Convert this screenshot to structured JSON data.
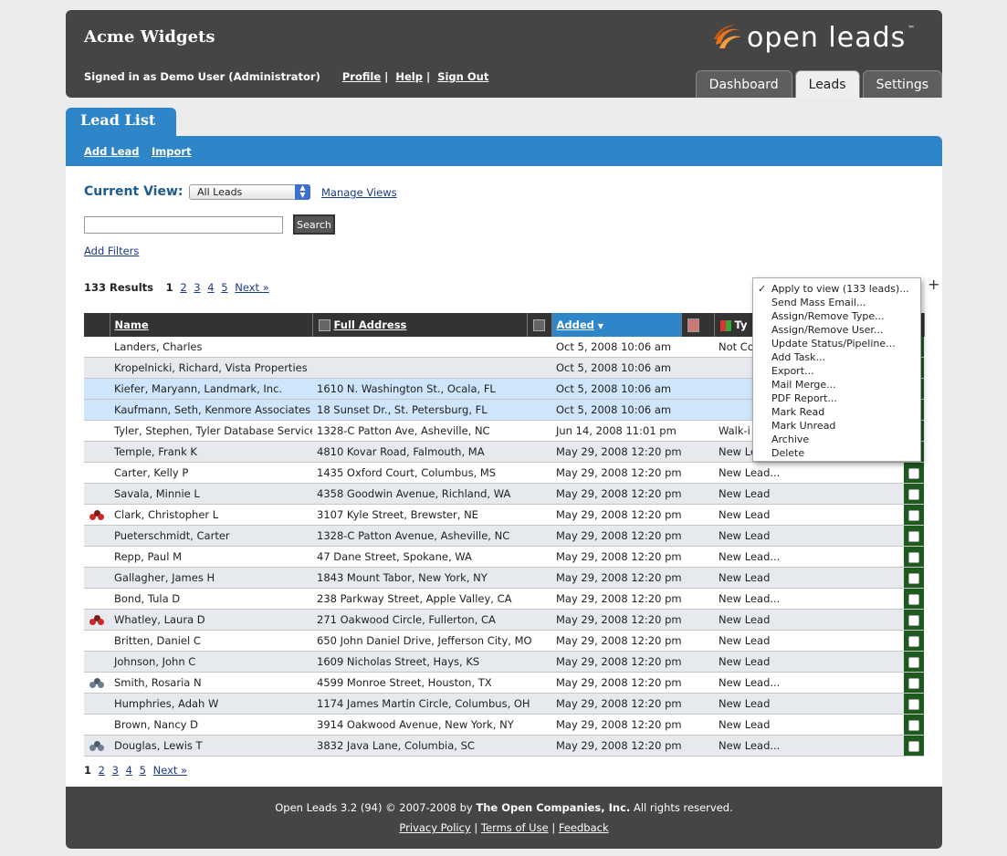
{
  "header": {
    "company": "Acme Widgets",
    "signed_in": "Signed in as Demo User (Administrator)",
    "links": {
      "profile": "Profile",
      "help": "Help",
      "sign_out": "Sign Out"
    },
    "logo": "open leads",
    "logo_tm": "™",
    "tabs": [
      "Dashboard",
      "Leads",
      "Settings"
    ],
    "active_tab": "Leads"
  },
  "page": {
    "title": "Lead List",
    "actions": {
      "add_lead": "Add Lead",
      "import": "Import"
    }
  },
  "controls": {
    "current_view_label": "Current View:",
    "current_view_value": "All Leads",
    "manage_views": "Manage Views",
    "search_value": "",
    "search_button": "Search",
    "add_filters": "Add Filters"
  },
  "results": {
    "count_label": "133 Results",
    "current_page": "1",
    "pages": [
      "2",
      "3",
      "4",
      "5"
    ],
    "next": "Next »"
  },
  "table": {
    "headers": {
      "name": "Name",
      "full_address": "Full Address",
      "added": "Added",
      "sort_arrow": "▼",
      "type": "Ty"
    },
    "rows": [
      {
        "icon": "",
        "name": "Landers, Charles",
        "address": "",
        "added": "Oct 5, 2008 10:06 am",
        "type": "Not Co",
        "style": "odd"
      },
      {
        "icon": "",
        "name": "Kropelnicki, Richard, Vista Properties",
        "address": "",
        "added": "Oct 5, 2008 10:06 am",
        "type": "",
        "style": "even"
      },
      {
        "icon": "",
        "name": "Kiefer, Maryann, Landmark, Inc.",
        "address": "1610 N. Washington St., Ocala, FL",
        "added": "Oct 5, 2008 10:06 am",
        "type": "",
        "style": "sel"
      },
      {
        "icon": "",
        "name": "Kaufmann, Seth, Kenmore Associates",
        "address": "18 Sunset Dr., St. Petersburg, FL",
        "added": "Oct 5, 2008 10:06 am",
        "type": "",
        "style": "sel"
      },
      {
        "icon": "",
        "name": "Tyler, Stephen, Tyler Database Services",
        "address": "1328-C Patton Ave, Asheville, NC",
        "added": "Jun 14, 2008 11:01 pm",
        "type": "Walk-i",
        "style": "odd"
      },
      {
        "icon": "",
        "name": "Temple, Frank K",
        "address": "4810 Kovar Road, Falmouth, MA",
        "added": "May 29, 2008 12:20 pm",
        "type": "New Le",
        "style": "even"
      },
      {
        "icon": "",
        "name": "Carter, Kelly P",
        "address": "1435 Oxford Court, Columbus, MS",
        "added": "May 29, 2008 12:20 pm",
        "type": "New Lead...",
        "style": "odd"
      },
      {
        "icon": "",
        "name": "Savala, Minnie L",
        "address": "4358 Goodwin Avenue, Richland, WA",
        "added": "May 29, 2008 12:20 pm",
        "type": "New Lead",
        "style": "even"
      },
      {
        "icon": "red",
        "name": "Clark, Christopher L",
        "address": "3107 Kyle Street, Brewster, NE",
        "added": "May 29, 2008 12:20 pm",
        "type": "New Lead",
        "style": "odd"
      },
      {
        "icon": "",
        "name": "Pueterschmidt, Carter",
        "address": "1328-C Patton Avenue, Asheville, NC",
        "added": "May 29, 2008 12:20 pm",
        "type": "New Lead",
        "style": "even"
      },
      {
        "icon": "",
        "name": "Repp, Paul M",
        "address": "47 Dane Street, Spokane, WA",
        "added": "May 29, 2008 12:20 pm",
        "type": "New Lead...",
        "style": "odd"
      },
      {
        "icon": "",
        "name": "Gallagher, James H",
        "address": "1843 Mount Tabor, New York, NY",
        "added": "May 29, 2008 12:20 pm",
        "type": "New Lead",
        "style": "even"
      },
      {
        "icon": "",
        "name": "Bond, Tula D",
        "address": "238 Parkway Street, Apple Valley, CA",
        "added": "May 29, 2008 12:20 pm",
        "type": "New Lead...",
        "style": "odd"
      },
      {
        "icon": "red",
        "name": "Whatley, Laura D",
        "address": "271 Oakwood Circle, Fullerton, CA",
        "added": "May 29, 2008 12:20 pm",
        "type": "New Lead",
        "style": "even"
      },
      {
        "icon": "",
        "name": "Britten, Daniel C",
        "address": "650 John Daniel Drive, Jefferson City, MO",
        "added": "May 29, 2008 12:20 pm",
        "type": "New Lead",
        "style": "odd"
      },
      {
        "icon": "",
        "name": "Johnson, John C",
        "address": "1609 Nicholas Street, Hays, KS",
        "added": "May 29, 2008 12:20 pm",
        "type": "New Lead",
        "style": "even"
      },
      {
        "icon": "gray",
        "name": "Smith, Rosaria N",
        "address": "4599 Monroe Street, Houston, TX",
        "added": "May 29, 2008 12:20 pm",
        "type": "New Lead...",
        "style": "odd"
      },
      {
        "icon": "",
        "name": "Humphries, Adah W",
        "address": "1174 James Martin Circle, Columbus, OH",
        "added": "May 29, 2008 12:20 pm",
        "type": "New Lead",
        "style": "even"
      },
      {
        "icon": "",
        "name": "Brown, Nancy D",
        "address": "3914 Oakwood Avenue, New York, NY",
        "added": "May 29, 2008 12:20 pm",
        "type": "New Lead",
        "style": "odd"
      },
      {
        "icon": "gray",
        "name": "Douglas, Lewis T",
        "address": "3832 Java Lane, Columbia, SC",
        "added": "May 29, 2008 12:20 pm",
        "type": "New Lead...",
        "style": "even"
      }
    ]
  },
  "menu": {
    "items": [
      {
        "label": "Apply to view (133 leads)...",
        "checked": true
      },
      {
        "label": "Send Mass Email...",
        "checked": false
      },
      {
        "label": "Assign/Remove Type...",
        "checked": false
      },
      {
        "label": "Assign/Remove User...",
        "checked": false
      },
      {
        "label": "Update Status/Pipeline...",
        "checked": false
      },
      {
        "label": "Add Task...",
        "checked": false
      },
      {
        "label": "Export...",
        "checked": false
      },
      {
        "label": "Mail Merge...",
        "checked": false
      },
      {
        "label": "PDF Report...",
        "checked": false
      },
      {
        "label": "Mark Read",
        "checked": false
      },
      {
        "label": "Mark Unread",
        "checked": false
      },
      {
        "label": "Archive",
        "checked": false
      },
      {
        "label": "Delete",
        "checked": false
      }
    ],
    "check_mark": "✓",
    "cursor": "+"
  },
  "footer": {
    "line1": "Open Leads 3.2 (94) © 2007-2008 by ",
    "company": "The Open Companies, Inc.",
    "rights": " All rights reserved.",
    "links": {
      "privacy": "Privacy Policy",
      "terms": "Terms of Use",
      "feedback": "Feedback"
    }
  },
  "colors": {
    "header_bg": "#454545",
    "accent_blue": "#2e86c8",
    "checkbox_col": "#1e5a1e",
    "selected_row": "#cfe5fb",
    "logo_orange": "#e8731c"
  }
}
